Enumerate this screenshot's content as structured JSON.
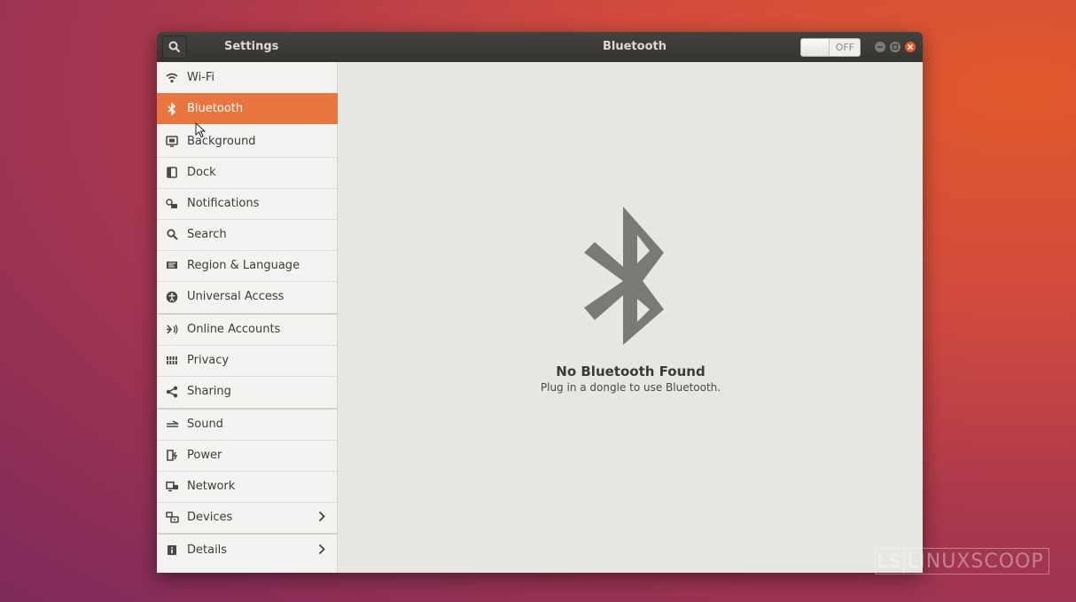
{
  "window": {
    "app_title": "Settings",
    "panel_title": "Bluetooth",
    "toggle_label": "OFF",
    "toggle_on": false
  },
  "sidebar": {
    "items": [
      {
        "label": "Wi-Fi",
        "icon": "wifi-icon"
      },
      {
        "label": "Bluetooth",
        "icon": "bluetooth-icon",
        "active": true
      },
      {
        "label": "Background",
        "icon": "background-icon"
      },
      {
        "label": "Dock",
        "icon": "dock-icon"
      },
      {
        "label": "Notifications",
        "icon": "notifications-icon"
      },
      {
        "label": "Search",
        "icon": "search-icon"
      },
      {
        "label": "Region & Language",
        "icon": "region-flag-icon"
      },
      {
        "label": "Universal Access",
        "icon": "universal-access-icon"
      },
      {
        "label": "Online Accounts",
        "icon": "online-accounts-icon"
      },
      {
        "label": "Privacy",
        "icon": "privacy-icon"
      },
      {
        "label": "Sharing",
        "icon": "sharing-icon"
      },
      {
        "label": "Sound",
        "icon": "sound-icon"
      },
      {
        "label": "Power",
        "icon": "power-icon"
      },
      {
        "label": "Network",
        "icon": "network-icon"
      },
      {
        "label": "Devices",
        "icon": "devices-icon",
        "has_submenu": true
      },
      {
        "label": "Details",
        "icon": "details-icon",
        "has_submenu": true
      }
    ]
  },
  "content": {
    "empty_title": "No Bluetooth Found",
    "empty_subtitle": "Plug in a dongle to use Bluetooth."
  },
  "watermark": {
    "box": "LS",
    "text": "LINUXSCOOP"
  },
  "colors": {
    "accent": "#e9763e",
    "titlebar": "#3c3b37",
    "close_button": "#ea5a2e"
  }
}
